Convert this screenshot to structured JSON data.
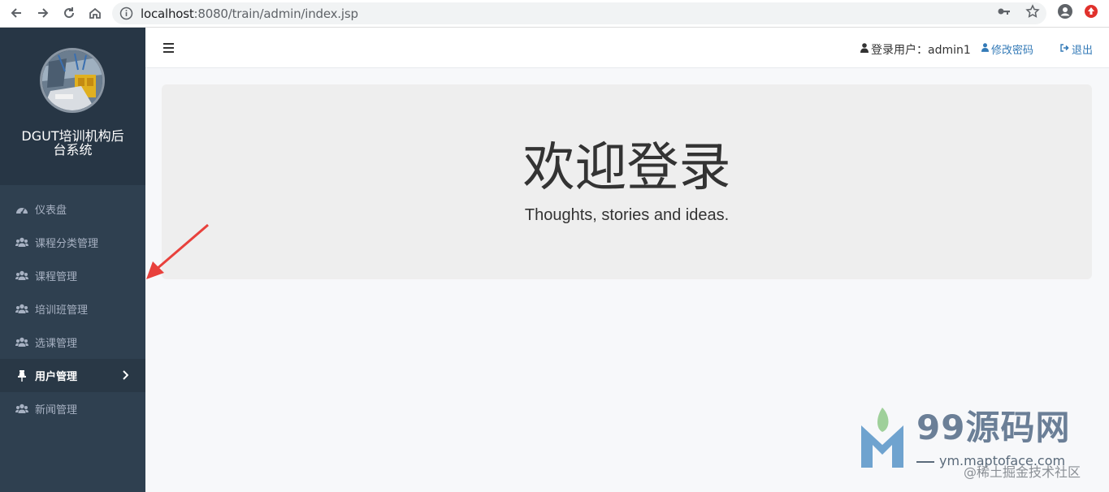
{
  "browser": {
    "url_host": "localhost",
    "url_path": ":8080/train/admin/index.jsp",
    "icons": [
      "back-icon",
      "forward-icon",
      "reload-icon",
      "home-icon",
      "info-icon",
      "key-icon",
      "star-icon",
      "account-icon",
      "extension-icon"
    ]
  },
  "sidebar": {
    "brand_line1": "DGUT培训机构后",
    "brand_line2": "台系统",
    "items": [
      {
        "label": "仪表盘",
        "icon": "dashboard-icon"
      },
      {
        "label": "课程分类管理",
        "icon": "users-icon"
      },
      {
        "label": "课程管理",
        "icon": "users-icon"
      },
      {
        "label": "培训班管理",
        "icon": "users-icon"
      },
      {
        "label": "选课管理",
        "icon": "users-icon"
      },
      {
        "label": "用户管理",
        "icon": "pin-icon",
        "active": true
      },
      {
        "label": "新闻管理",
        "icon": "users-icon"
      }
    ]
  },
  "topnav": {
    "user_label": "登录用户：admin1",
    "change_password": "修改密码",
    "logout": "退出"
  },
  "jumbotron": {
    "title": "欢迎登录",
    "subtitle": "Thoughts, stories and ideas."
  },
  "watermark": {
    "title": "99源码网",
    "url": "ym.maptoface.com",
    "credit": "@稀土掘金技术社区"
  },
  "colors": {
    "sidebar_bg": "#2f4050",
    "sidebar_header_bg": "#273645",
    "active_item_bg": "#293846",
    "link": "#337ab7",
    "jumbotron_bg": "#eeeeee",
    "annotation_arrow": "#e8413c"
  }
}
